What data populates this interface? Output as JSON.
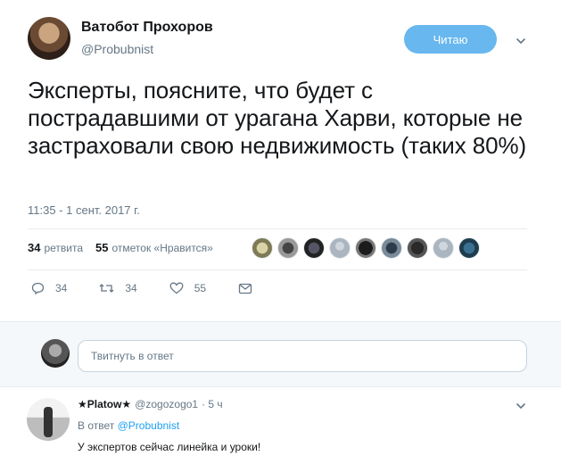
{
  "tweet": {
    "author_name": "Ватобот Прохоров",
    "author_handle": "@Probubnist",
    "follow_label": "Читаю",
    "text": "Эксперты, поясните, что будет с пострадавшими от урагана Харви, которые не застраховали свою недвижимость (таких 80%)",
    "timestamp": "11:35 - 1 сент. 2017 г.",
    "retweets_count": "34",
    "retweets_label": "ретвита",
    "likes_count": "55",
    "likes_label": "отметок «Нравится»",
    "liker_avatars": [
      "avatar-1",
      "avatar-2",
      "avatar-3",
      "avatar-4",
      "avatar-5",
      "avatar-6",
      "avatar-7",
      "avatar-8",
      "avatar-9"
    ],
    "actions": {
      "reply_count": "34",
      "retweet_count": "34",
      "like_count": "55"
    }
  },
  "reply_box": {
    "placeholder": "Твитнуть в ответ"
  },
  "reply": {
    "author_name": "★Platow★",
    "author_handle": "@zogozogo1",
    "time": "· 5 ч",
    "reply_to_prefix": "В ответ",
    "reply_to_handle": "@Probubnist",
    "text": "У экспертов сейчас линейка и уроки!"
  },
  "colors": {
    "follow_button": "#68b7ee",
    "link": "#1da1f2",
    "secondary_text": "#657786",
    "band_background": "#f5f8fa"
  },
  "icons": [
    "chevron-down-icon",
    "reply-icon",
    "retweet-icon",
    "heart-icon",
    "message-icon"
  ]
}
